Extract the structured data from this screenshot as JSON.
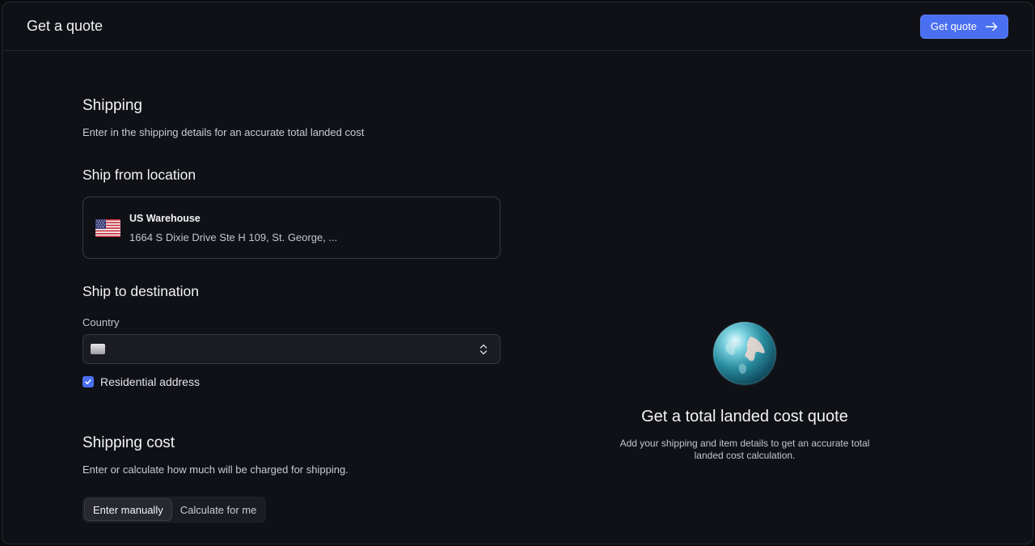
{
  "header": {
    "title": "Get a quote",
    "get_quote_label": "Get quote"
  },
  "shipping": {
    "title": "Shipping",
    "subtitle": "Enter in the shipping details for an accurate total landed cost"
  },
  "ship_from": {
    "title": "Ship from location",
    "location_name": "US Warehouse",
    "location_address": "1664 S Dixie Drive Ste H 109, St. George, ...",
    "flag_icon": "us-flag-icon"
  },
  "ship_to": {
    "title": "Ship to destination",
    "country_label": "Country",
    "country_value": "",
    "residential_label": "Residential address",
    "residential_checked": true
  },
  "shipping_cost": {
    "title": "Shipping cost",
    "subtitle": "Enter or calculate how much will be charged for shipping.",
    "options": [
      "Enter manually",
      "Calculate for me"
    ],
    "selected": "Enter manually"
  },
  "empty_state": {
    "title": "Get a total landed cost quote",
    "description": "Add your shipping and item details to get an accurate total landed cost calculation.",
    "icon": "globe-icon"
  },
  "colors": {
    "accent": "#4a6ff0",
    "background": "#101116",
    "border": "#363842"
  }
}
